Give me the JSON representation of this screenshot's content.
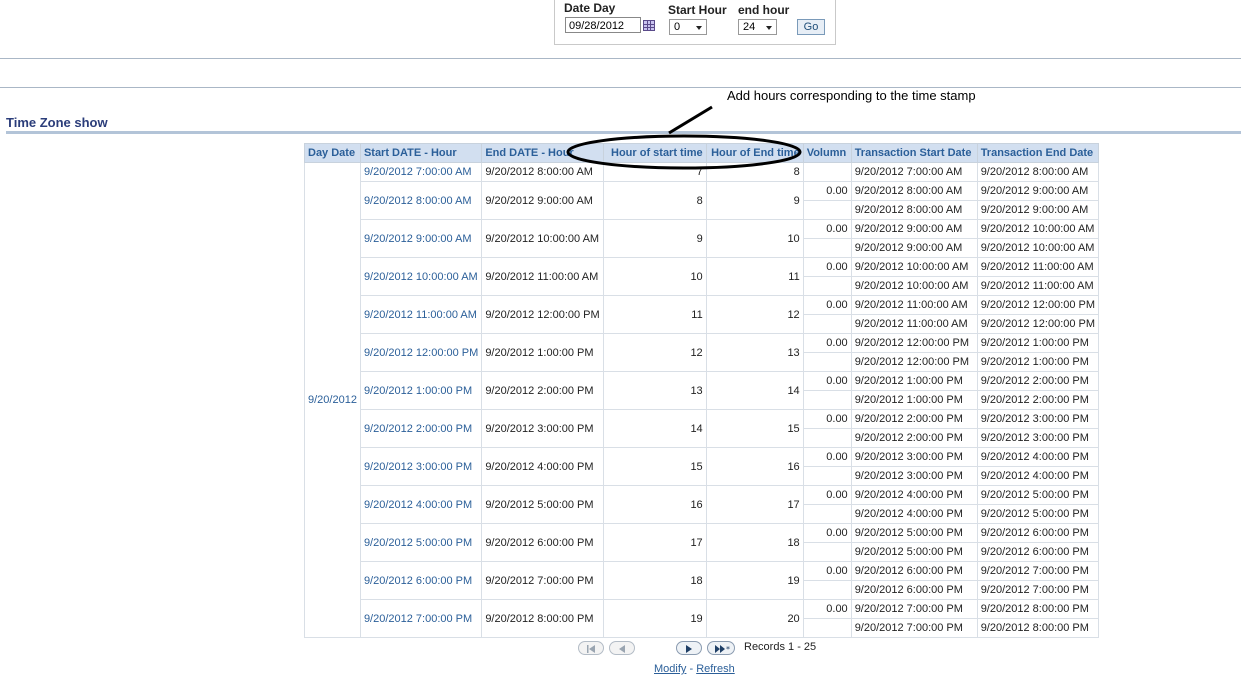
{
  "prompt": {
    "date_label": "Date Day",
    "date_value": "09/28/2012",
    "start_label": "Start Hour",
    "start_value": "0",
    "end_label": "end hour",
    "end_value": "24",
    "go_label": "Go"
  },
  "annotation": "Add hours corresponding to the time stamp",
  "section_title": "Time Zone show",
  "table": {
    "headers": [
      "Day Date",
      "Start DATE - Hour",
      "End DATE - Hour",
      "Hour of start time",
      "Hour of End time",
      "Volumn",
      "Transaction Start Date",
      "Transaction End Date"
    ],
    "day": "9/20/2012",
    "groups": [
      {
        "start": "9/20/2012 7:00:00 AM",
        "end": "9/20/2012 8:00:00 AM",
        "hs": "7",
        "he": "8",
        "subs": [
          {
            "vol": "",
            "ts": "9/20/2012 7:00:00 AM",
            "te": "9/20/2012 8:00:00 AM"
          }
        ]
      },
      {
        "start": "9/20/2012 8:00:00 AM",
        "end": "9/20/2012 9:00:00 AM",
        "hs": "8",
        "he": "9",
        "subs": [
          {
            "vol": "0.00",
            "ts": "9/20/2012 8:00:00 AM",
            "te": "9/20/2012 9:00:00 AM"
          },
          {
            "vol": "",
            "ts": "9/20/2012 8:00:00 AM",
            "te": "9/20/2012 9:00:00 AM"
          }
        ]
      },
      {
        "start": "9/20/2012 9:00:00 AM",
        "end": "9/20/2012 10:00:00 AM",
        "hs": "9",
        "he": "10",
        "subs": [
          {
            "vol": "0.00",
            "ts": "9/20/2012 9:00:00 AM",
            "te": "9/20/2012 10:00:00 AM"
          },
          {
            "vol": "",
            "ts": "9/20/2012 9:00:00 AM",
            "te": "9/20/2012 10:00:00 AM"
          }
        ]
      },
      {
        "start": "9/20/2012 10:00:00 AM",
        "end": "9/20/2012 11:00:00 AM",
        "hs": "10",
        "he": "11",
        "subs": [
          {
            "vol": "0.00",
            "ts": "9/20/2012 10:00:00 AM",
            "te": "9/20/2012 11:00:00 AM"
          },
          {
            "vol": "",
            "ts": "9/20/2012 10:00:00 AM",
            "te": "9/20/2012 11:00:00 AM"
          }
        ]
      },
      {
        "start": "9/20/2012 11:00:00 AM",
        "end": "9/20/2012 12:00:00 PM",
        "hs": "11",
        "he": "12",
        "subs": [
          {
            "vol": "0.00",
            "ts": "9/20/2012 11:00:00 AM",
            "te": "9/20/2012 12:00:00 PM"
          },
          {
            "vol": "",
            "ts": "9/20/2012 11:00:00 AM",
            "te": "9/20/2012 12:00:00 PM"
          }
        ]
      },
      {
        "start": "9/20/2012 12:00:00 PM",
        "end": "9/20/2012 1:00:00 PM",
        "hs": "12",
        "he": "13",
        "subs": [
          {
            "vol": "0.00",
            "ts": "9/20/2012 12:00:00 PM",
            "te": "9/20/2012 1:00:00 PM"
          },
          {
            "vol": "",
            "ts": "9/20/2012 12:00:00 PM",
            "te": "9/20/2012 1:00:00 PM"
          }
        ]
      },
      {
        "start": "9/20/2012 1:00:00 PM",
        "end": "9/20/2012 2:00:00 PM",
        "hs": "13",
        "he": "14",
        "subs": [
          {
            "vol": "0.00",
            "ts": "9/20/2012 1:00:00 PM",
            "te": "9/20/2012 2:00:00 PM"
          },
          {
            "vol": "",
            "ts": "9/20/2012 1:00:00 PM",
            "te": "9/20/2012 2:00:00 PM"
          }
        ]
      },
      {
        "start": "9/20/2012 2:00:00 PM",
        "end": "9/20/2012 3:00:00 PM",
        "hs": "14",
        "he": "15",
        "subs": [
          {
            "vol": "0.00",
            "ts": "9/20/2012 2:00:00 PM",
            "te": "9/20/2012 3:00:00 PM"
          },
          {
            "vol": "",
            "ts": "9/20/2012 2:00:00 PM",
            "te": "9/20/2012 3:00:00 PM"
          }
        ]
      },
      {
        "start": "9/20/2012 3:00:00 PM",
        "end": "9/20/2012 4:00:00 PM",
        "hs": "15",
        "he": "16",
        "subs": [
          {
            "vol": "0.00",
            "ts": "9/20/2012 3:00:00 PM",
            "te": "9/20/2012 4:00:00 PM"
          },
          {
            "vol": "",
            "ts": "9/20/2012 3:00:00 PM",
            "te": "9/20/2012 4:00:00 PM"
          }
        ]
      },
      {
        "start": "9/20/2012 4:00:00 PM",
        "end": "9/20/2012 5:00:00 PM",
        "hs": "16",
        "he": "17",
        "subs": [
          {
            "vol": "0.00",
            "ts": "9/20/2012 4:00:00 PM",
            "te": "9/20/2012 5:00:00 PM"
          },
          {
            "vol": "",
            "ts": "9/20/2012 4:00:00 PM",
            "te": "9/20/2012 5:00:00 PM"
          }
        ]
      },
      {
        "start": "9/20/2012 5:00:00 PM",
        "end": "9/20/2012 6:00:00 PM",
        "hs": "17",
        "he": "18",
        "subs": [
          {
            "vol": "0.00",
            "ts": "9/20/2012 5:00:00 PM",
            "te": "9/20/2012 6:00:00 PM"
          },
          {
            "vol": "",
            "ts": "9/20/2012 5:00:00 PM",
            "te": "9/20/2012 6:00:00 PM"
          }
        ]
      },
      {
        "start": "9/20/2012 6:00:00 PM",
        "end": "9/20/2012 7:00:00 PM",
        "hs": "18",
        "he": "19",
        "subs": [
          {
            "vol": "0.00",
            "ts": "9/20/2012 6:00:00 PM",
            "te": "9/20/2012 7:00:00 PM"
          },
          {
            "vol": "",
            "ts": "9/20/2012 6:00:00 PM",
            "te": "9/20/2012 7:00:00 PM"
          }
        ]
      },
      {
        "start": "9/20/2012 7:00:00 PM",
        "end": "9/20/2012 8:00:00 PM",
        "hs": "19",
        "he": "20",
        "subs": [
          {
            "vol": "0.00",
            "ts": "9/20/2012 7:00:00 PM",
            "te": "9/20/2012 8:00:00 PM"
          },
          {
            "vol": "",
            "ts": "9/20/2012 7:00:00 PM",
            "te": "9/20/2012 8:00:00 PM"
          }
        ]
      }
    ]
  },
  "pagination": {
    "records": "Records 1 - 25",
    "modify": "Modify",
    "separator": " - ",
    "refresh": "Refresh"
  }
}
